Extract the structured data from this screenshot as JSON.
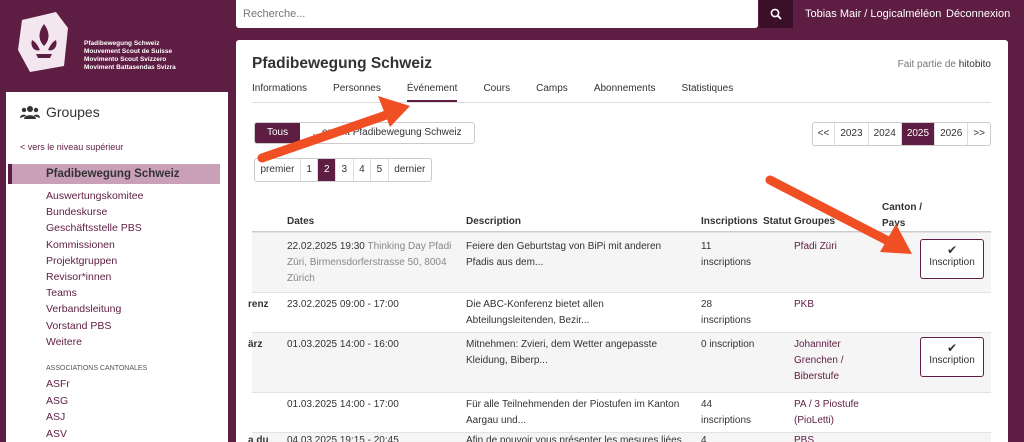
{
  "header": {
    "logo_lines": [
      "Pfadibewegung Schweiz",
      "Mouvement Scout de Suisse",
      "Movimento Scout Svizzero",
      "Moviment Battasendas Svizra"
    ],
    "search_placeholder": "Recherche...",
    "user": "Tobias Mair / Logicalméléon",
    "logout": "Déconnexion"
  },
  "sidebar": {
    "title": "Groupes",
    "up_link": "< vers le niveau supérieur",
    "active": "Pfadibewegung Schweiz",
    "items": [
      "Auswertungskomitee",
      "Bundeskurse",
      "Geschäftsstelle PBS",
      "Kommissionen",
      "Projektgruppen",
      "Revisor*innen",
      "Teams",
      "Verbandsleitung",
      "Vorstand PBS",
      "Weitere"
    ],
    "category": "ASSOCIATIONS CANTONALES",
    "cantonal": [
      "ASFr",
      "ASG",
      "ASJ",
      "ASV"
    ]
  },
  "main": {
    "title": "Pfadibewegung Schweiz",
    "part_of_label": "Fait partie de",
    "part_of_link": "hitobito",
    "tabs": [
      "Informations",
      "Personnes",
      "Événement",
      "Cours",
      "Camps",
      "Abonnements",
      "Statistiques"
    ],
    "active_tab": "Événement",
    "filter": [
      "Tous",
      "…ement Pfadibewegung Schweiz"
    ],
    "years": [
      "<<",
      "2023",
      "2024",
      "2025",
      "2026",
      ">>"
    ],
    "active_year": "2025",
    "pager": [
      "premier",
      "1",
      "2",
      "3",
      "4",
      "5",
      "dernier"
    ],
    "active_page": "2",
    "columns": [
      "Dates",
      "Description",
      "Inscriptions",
      "Statut",
      "Groupes",
      "Canton / Pays"
    ],
    "button_label": "Inscription",
    "rows": [
      {
        "name_cut": "",
        "date": "22.02.2025 19:30",
        "location": "Thinking Day Pfadi Züri, Birmensdorferstrasse 50, 8004 Zürich",
        "desc": "Feiere den Geburtstag von BiPi mit anderen Pfadis aus dem...",
        "inscriptions": "11 inscriptions",
        "groups": "Pfadi Züri",
        "button": true
      },
      {
        "name_cut": "renz",
        "date": "23.02.2025 09:00 - 17:00",
        "location": "",
        "desc": "Die ABC-Konferenz bietet allen Abteilungsleitenden, Bezir...",
        "inscriptions": "28 inscriptions",
        "groups": "PKB",
        "button": false
      },
      {
        "name_cut": "ärz",
        "date": "01.03.2025 14:00 - 16:00",
        "location": "",
        "desc": "Mitnehmen: Zvieri, dem Wetter angepasste Kleidung, Biberp...",
        "inscriptions": "0 inscription",
        "groups": "Johanniter Grenchen / Biberstufe",
        "button": true
      },
      {
        "name_cut": "",
        "date": "01.03.2025 14:00 - 17:00",
        "location": "",
        "desc": "Für alle Teilnehmenden der Piostufen im Kanton Aargau und...",
        "inscriptions": "44 inscriptions",
        "groups": "PA / 3 Piostufe (PioLetti)",
        "button": false
      },
      {
        "name_cut": "a du",
        "date": "04.03.2025 19:15 - 20:45",
        "location": "",
        "desc": "Afin de pouvoir vous présenter les mesures liées",
        "inscriptions": "4",
        "groups": "PBS",
        "button": false
      }
    ]
  },
  "colors": {
    "brand": "#5e1d42",
    "arrow": "#f04e23"
  }
}
